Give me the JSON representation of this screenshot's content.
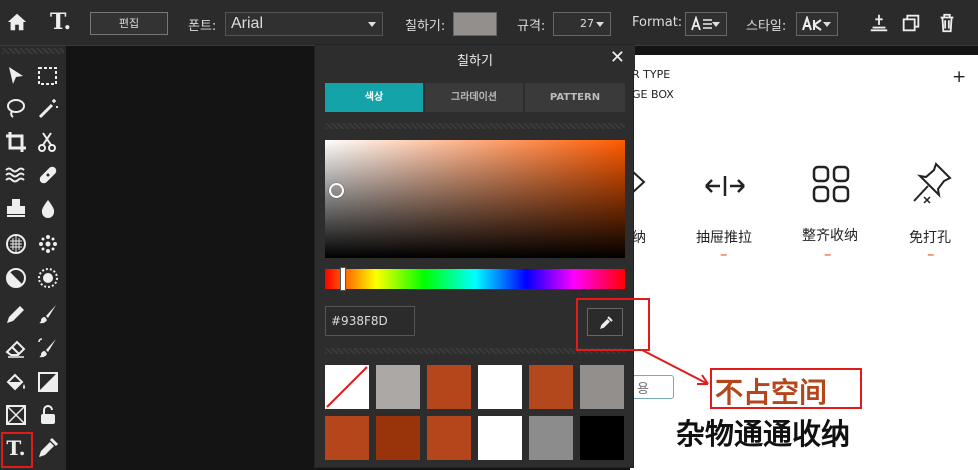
{
  "toolbar": {
    "edit_label": "편집",
    "font_label": "폰트:",
    "font_value": "Arial",
    "fill_label": "칠하기:",
    "fill_color": "#938F8D",
    "size_label": "규격:",
    "size_value": "27",
    "format_label": "Format:",
    "style_label": "스타일:"
  },
  "dialog": {
    "title": "칠하기",
    "close": "✕",
    "tabs": [
      {
        "label": "색상",
        "active": true
      },
      {
        "label": "그라데이션",
        "active": false
      },
      {
        "label": "PATTERN",
        "active": false
      }
    ],
    "hex_value": "#938F8D",
    "swatches": [
      "none",
      "#ABA8A6",
      "#B5461B",
      "#FFFFFF",
      "#B2481C",
      "#938F8D",
      "#B5461B",
      "#993309",
      "#B5461B",
      "#FFFFFF",
      "#8C8C8C",
      "#000000"
    ]
  },
  "product": {
    "type_line1": "R TYPE",
    "type_line2": "GE BOX",
    "plus": "+",
    "partial_label": "纳",
    "features": [
      {
        "label": "抽屉推拉",
        "icon": "push-pull-arrows-icon"
      },
      {
        "label": "整齐收纳",
        "icon": "four-squares-icon"
      },
      {
        "label": "免打孔",
        "icon": "pushpin-icon"
      }
    ],
    "dash": "–"
  },
  "lower": {
    "tag_fragment": "용",
    "annotation": "不占空间",
    "headline": "杂物通通收纳"
  },
  "colors": {
    "highlight_red": "#E31A1A",
    "tab_active": "#13A3A8",
    "accent_orange": "#E6500F",
    "annotation_text": "#B5461B"
  }
}
